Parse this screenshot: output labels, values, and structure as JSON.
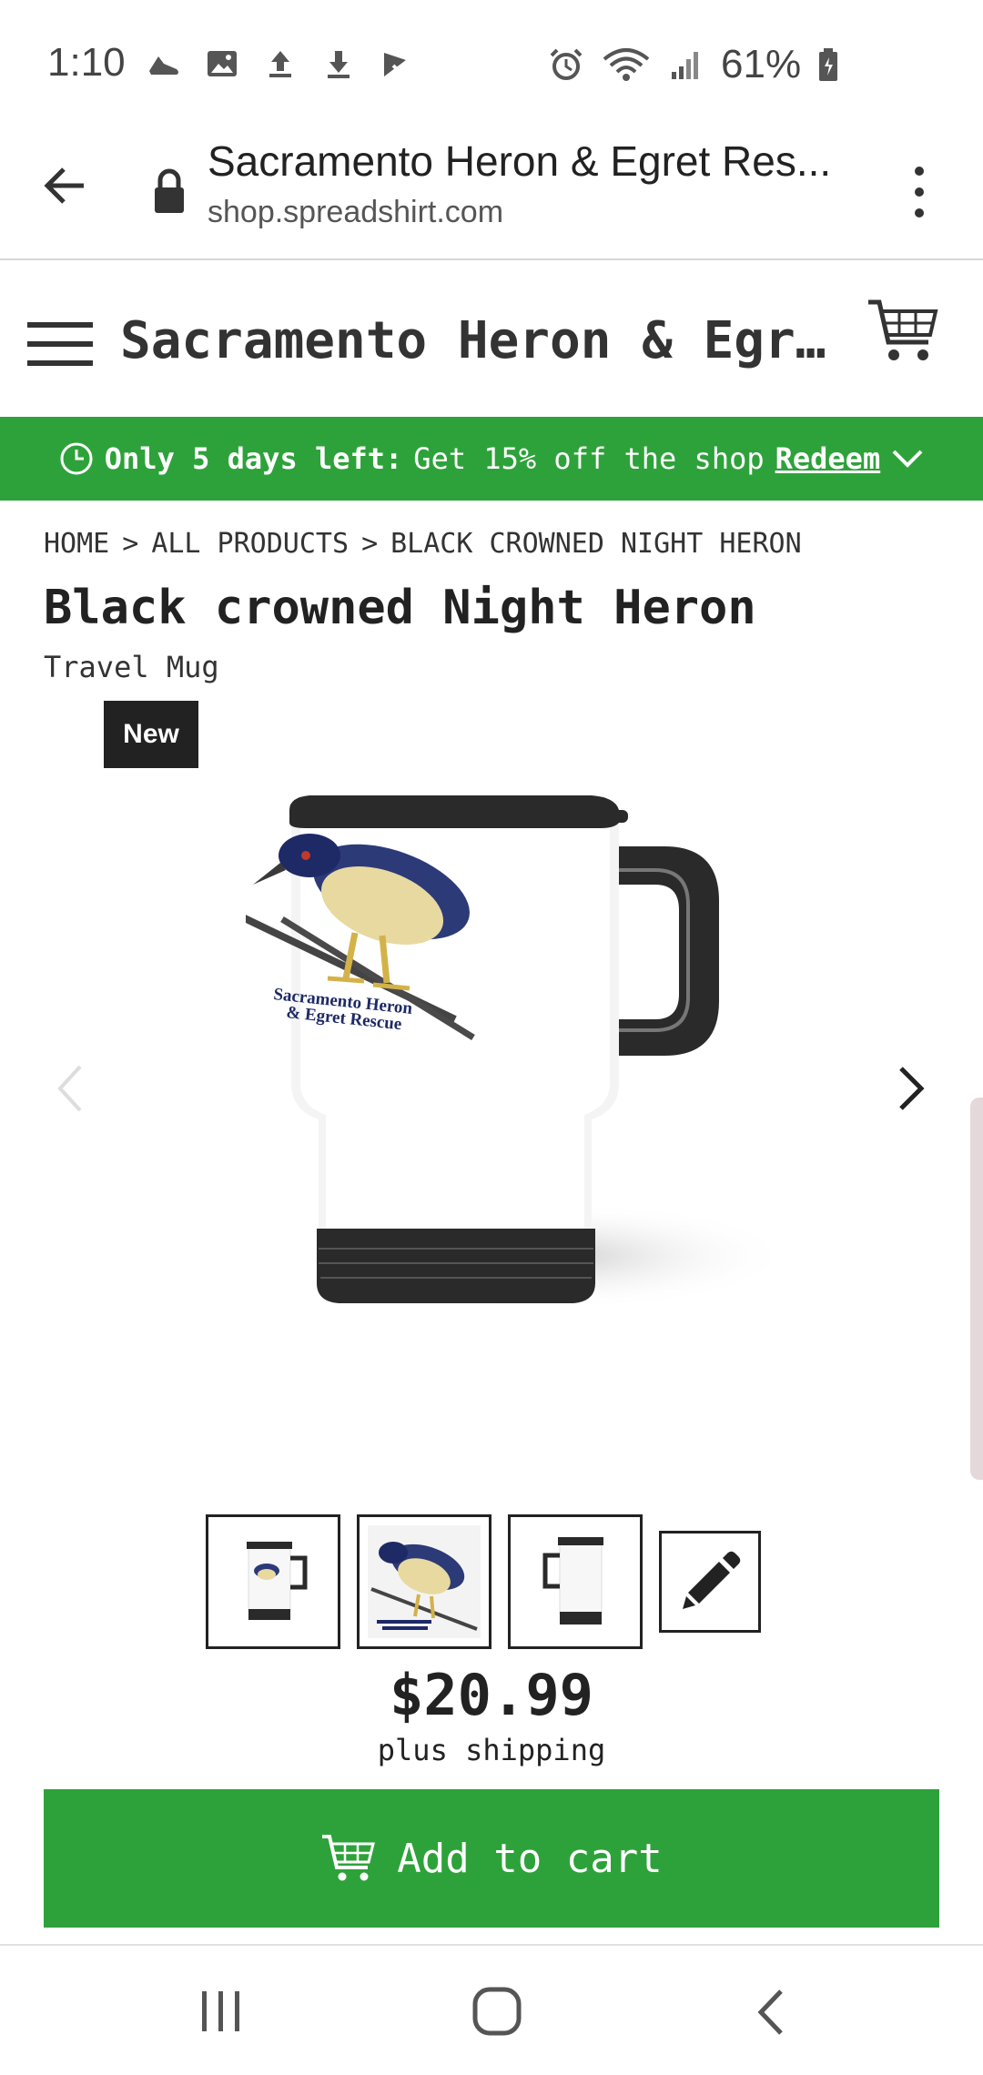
{
  "status_bar": {
    "time": "1:10",
    "battery": "61%",
    "icons_left": [
      "shoe-icon",
      "image-icon",
      "upload-icon",
      "download-icon",
      "check-flag-icon"
    ],
    "icons_right": [
      "alarm-icon",
      "wifi-icon",
      "signal-icon",
      "battery-icon"
    ]
  },
  "browser": {
    "page_title": "Sacramento Heron & Egret Res...",
    "domain": "shop.spreadshirt.com"
  },
  "shop": {
    "title": "Sacramento Heron & Egret …"
  },
  "promo": {
    "bold_text": "Only 5 days left:",
    "text": "Get 15% off the shop",
    "link": "Redeem",
    "color": "#2ea23a"
  },
  "breadcrumb": [
    "HOME",
    ">",
    "ALL PRODUCTS",
    ">",
    "BLACK CROWNED NIGHT HERON"
  ],
  "product": {
    "title": "Black crowned Night Heron",
    "subtitle": "Travel Mug",
    "badge": "New",
    "print_line1": "Sacramento Heron",
    "print_line2": "& Egret Rescue",
    "thumbnails": [
      "mug-front-thumb",
      "design-thumb",
      "mug-back-thumb",
      "edit-pencil-icon"
    ],
    "price": "$20.99",
    "price_note": "plus shipping",
    "cta": "Add to cart"
  },
  "nav": [
    "recent-apps-icon",
    "home-icon",
    "back-icon"
  ]
}
